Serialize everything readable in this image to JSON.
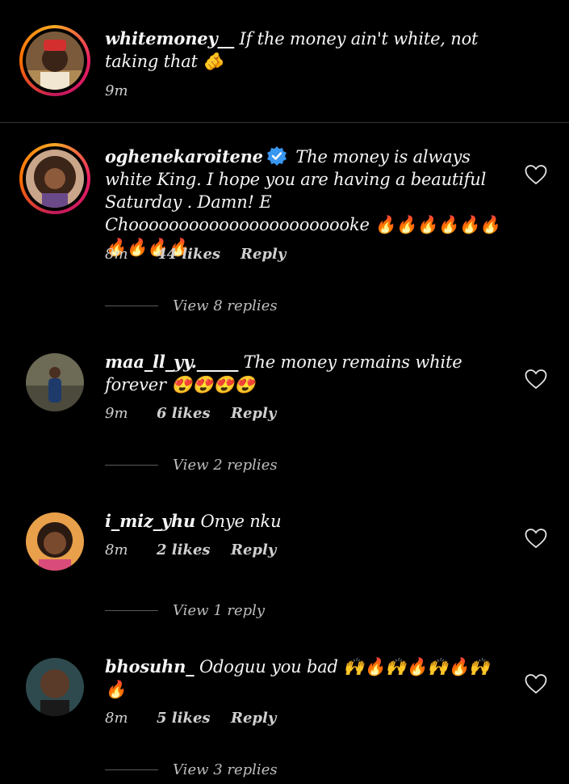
{
  "caption": {
    "username": "whitemoney__",
    "text": " If the money ain't white, not taking that 🫵",
    "time": "9m"
  },
  "comments": [
    {
      "username": "oghenekaroitene",
      "verified": true,
      "text": " The money is always white King. I hope you are having a beautiful Saturday . Damn! E Chooooooooooooooooooooooke 🔥🔥🔥🔥🔥🔥🔥🔥🔥🔥",
      "time": "8m",
      "likes": "44 likes",
      "reply": "Reply",
      "view_replies": "View 8 replies"
    },
    {
      "username": "maa_ll_yy._____",
      "verified": false,
      "text": " The money remains white forever 😍😍😍😍",
      "time": "9m",
      "likes": "6 likes",
      "reply": "Reply",
      "view_replies": "View 2 replies"
    },
    {
      "username": "i_miz_yhu",
      "verified": false,
      "text": " Onye nku",
      "time": "8m",
      "likes": "2 likes",
      "reply": "Reply",
      "view_replies": "View 1 reply"
    },
    {
      "username": "bhosuhn_",
      "verified": false,
      "text": " Odoguu you bad 🙌🔥🙌🔥🙌🔥🙌🔥",
      "time": "8m",
      "likes": "5 likes",
      "reply": "Reply",
      "view_replies": "View 3 replies"
    }
  ],
  "colors": {
    "background": "#000000",
    "text": "#f5f5f5",
    "muted": "#cfcfcf",
    "verified": "#3897f0"
  }
}
